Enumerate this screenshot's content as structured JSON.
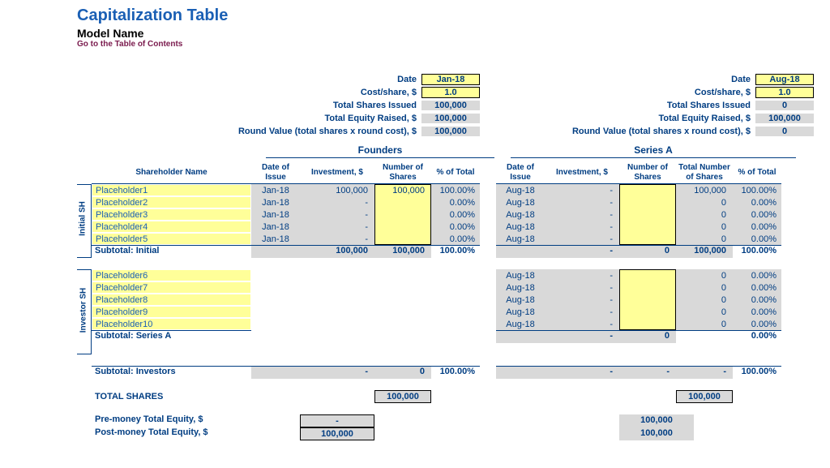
{
  "header": {
    "title": "Capitalization Table",
    "subtitle": "Model Name",
    "toc_link": "Go to the Table of Contents"
  },
  "summary": {
    "labels": {
      "date": "Date",
      "cost": "Cost/share, $",
      "shares": "Total Shares Issued",
      "equity": "Total Equity Raised, $",
      "round": "Round Value (total shares x round cost), $"
    },
    "founders": {
      "date": "Jan-18",
      "cost": "1.0",
      "shares": "100,000",
      "equity": "100,000",
      "round": "100,000"
    },
    "seriesa": {
      "date": "Aug-18",
      "cost": "1.0",
      "shares": "0",
      "equity": "100,000",
      "round": "0"
    }
  },
  "columns": {
    "shareholder": "Shareholder Name",
    "founders_title": "Founders",
    "seriesa_title": "Series A",
    "date": "Date of Issue",
    "investment": "Investment, $",
    "shares": "Number of Shares",
    "total_shares": "Total Number of Shares",
    "pct": "% of Total"
  },
  "groups": {
    "initial_label": "Initial SH",
    "investor_label": "Investor SH"
  },
  "initial": [
    {
      "name": "Placeholder1",
      "f_date": "Jan-18",
      "f_inv": "100,000",
      "f_sh": "100,000",
      "f_pct": "100.00%",
      "a_date": "Aug-18",
      "a_inv": "-",
      "a_sh": "",
      "a_tot": "100,000",
      "a_pct": "100.00%"
    },
    {
      "name": "Placeholder2",
      "f_date": "Jan-18",
      "f_inv": "-",
      "f_sh": "",
      "f_pct": "0.00%",
      "a_date": "Aug-18",
      "a_inv": "-",
      "a_sh": "",
      "a_tot": "0",
      "a_pct": "0.00%"
    },
    {
      "name": "Placeholder3",
      "f_date": "Jan-18",
      "f_inv": "-",
      "f_sh": "",
      "f_pct": "0.00%",
      "a_date": "Aug-18",
      "a_inv": "-",
      "a_sh": "",
      "a_tot": "0",
      "a_pct": "0.00%"
    },
    {
      "name": "Placeholder4",
      "f_date": "Jan-18",
      "f_inv": "-",
      "f_sh": "",
      "f_pct": "0.00%",
      "a_date": "Aug-18",
      "a_inv": "-",
      "a_sh": "",
      "a_tot": "0",
      "a_pct": "0.00%"
    },
    {
      "name": "Placeholder5",
      "f_date": "Jan-18",
      "f_inv": "-",
      "f_sh": "",
      "f_pct": "0.00%",
      "a_date": "Aug-18",
      "a_inv": "-",
      "a_sh": "",
      "a_tot": "0",
      "a_pct": "0.00%"
    }
  ],
  "subtotal_initial": {
    "label": "Subtotal: Initial",
    "f_inv": "100,000",
    "f_sh": "100,000",
    "f_pct": "100.00%",
    "a_inv": "-",
    "a_sh": "0",
    "a_tot": "100,000",
    "a_pct": "100.00%"
  },
  "investors": [
    {
      "name": "Placeholder6",
      "a_date": "Aug-18",
      "a_inv": "-",
      "a_sh": "",
      "a_tot": "0",
      "a_pct": "0.00%"
    },
    {
      "name": "Placeholder7",
      "a_date": "Aug-18",
      "a_inv": "-",
      "a_sh": "",
      "a_tot": "0",
      "a_pct": "0.00%"
    },
    {
      "name": "Placeholder8",
      "a_date": "Aug-18",
      "a_inv": "-",
      "a_sh": "",
      "a_tot": "0",
      "a_pct": "0.00%"
    },
    {
      "name": "Placeholder9",
      "a_date": "Aug-18",
      "a_inv": "-",
      "a_sh": "",
      "a_tot": "0",
      "a_pct": "0.00%"
    },
    {
      "name": "Placeholder10",
      "a_date": "Aug-18",
      "a_inv": "-",
      "a_sh": "",
      "a_tot": "0",
      "a_pct": "0.00%"
    }
  ],
  "subtotal_seriesa": {
    "label": "Subtotal: Series A",
    "a_inv": "-",
    "a_sh": "0",
    "a_tot": "",
    "a_pct": "0.00%"
  },
  "subtotal_investors": {
    "label": "Subtotal: Investors",
    "f_inv": "-",
    "f_sh": "0",
    "f_pct": "100.00%",
    "a_inv": "-",
    "a_sh": "-",
    "a_tot": "-",
    "a_pct": "100.00%"
  },
  "totals": {
    "shares_label": "TOTAL SHARES",
    "shares_f": "100,000",
    "shares_a": "100,000",
    "pre_label": "Pre-money Total Equity, $",
    "pre_f": "-",
    "pre_a": "100,000",
    "post_label": "Post-money Total Equity, $",
    "post_f": "100,000",
    "post_a": "100,000"
  }
}
